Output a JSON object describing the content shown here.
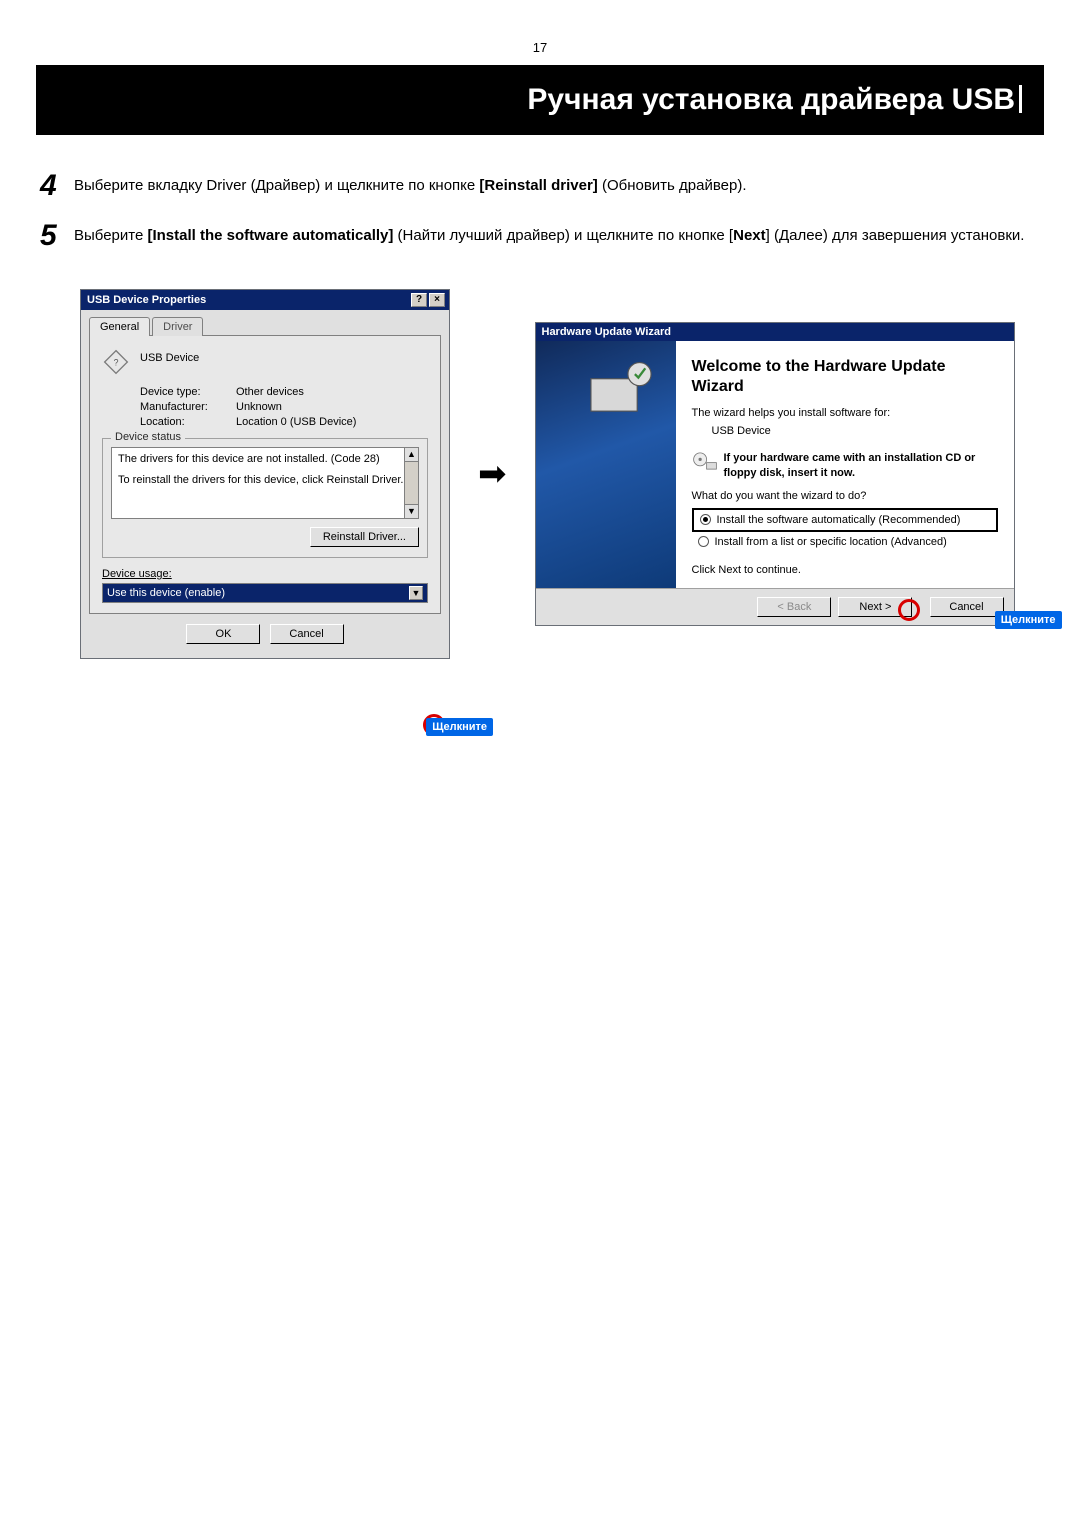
{
  "page_number": "17",
  "title": "Ручная установка драйвера USB",
  "steps": {
    "s4": {
      "num": "4",
      "text_before": "Выберите вкладку Driver (Драйвер) и щелкните по кнопке ",
      "bold": "[Reinstall driver]",
      "text_after": " (Обновить драйвер)."
    },
    "s5": {
      "num": "5",
      "text_before": "Выберите ",
      "bold1": "[Install the software automatically]",
      "mid": " (Найти лучший драйвер) и щелкните по кнопке [",
      "bold2": "Next",
      "text_after": "] (Далее) для завершения установки."
    }
  },
  "callout_label": "Щелкните",
  "arrow_glyph": "➡",
  "left_dialog": {
    "title": "USB Device Properties",
    "help_btn": "?",
    "close_btn": "×",
    "tabs": {
      "general": "General",
      "driver": "Driver"
    },
    "device_name": "USB Device",
    "rows": {
      "device_type_label": "Device type:",
      "device_type_value": "Other devices",
      "manufacturer_label": "Manufacturer:",
      "manufacturer_value": "Unknown",
      "location_label": "Location:",
      "location_value": "Location 0 (USB Device)"
    },
    "group_legend": "Device status",
    "status_line1": "The drivers for this device are not installed. (Code 28)",
    "status_line2": "To reinstall the drivers for this device, click Reinstall Driver.",
    "reinstall_btn": "Reinstall Driver...",
    "usage_label": "Device usage:",
    "usage_value": "Use this device (enable)",
    "ok_btn": "OK",
    "cancel_btn": "Cancel",
    "sb_up": "▲",
    "sb_down": "▼",
    "dd_arrow": "▼"
  },
  "right_dialog": {
    "title": "Hardware Update Wizard",
    "heading": "Welcome to the Hardware Update Wizard",
    "intro": "The wizard helps you install software for:",
    "device": "USB Device",
    "tip": "If your hardware came with an installation CD or floppy disk, insert it now.",
    "question": "What do you want the wizard to do?",
    "opt_auto_before": "Install the software automatically (Recommended)",
    "opt_list": "Install from a list or specific location (Advanced)",
    "continue_text": "Click Next to continue.",
    "back_btn": "< Back",
    "next_btn": "Next >",
    "cancel_btn": "Cancel"
  }
}
